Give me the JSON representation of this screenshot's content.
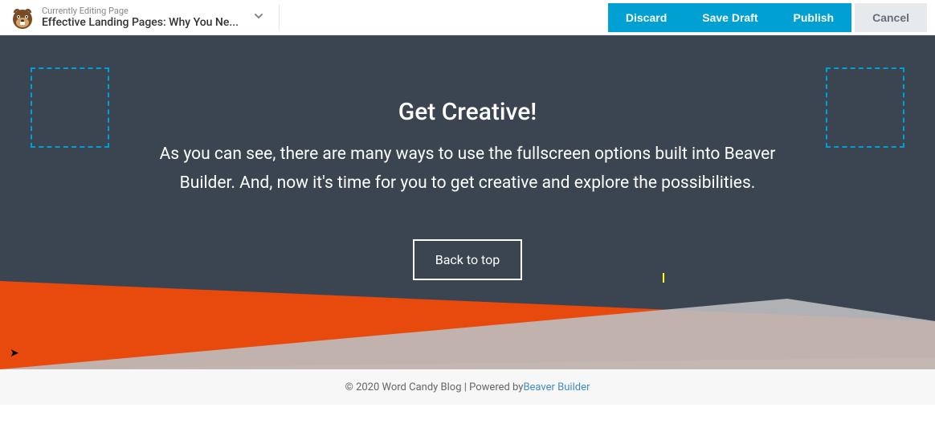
{
  "toolbar": {
    "editing_label": "Currently Editing Page",
    "page_title": "Effective Landing Pages: Why You Ne...",
    "discard": "Discard",
    "save_draft": "Save Draft",
    "publish": "Publish",
    "cancel": "Cancel"
  },
  "hero": {
    "heading": "Get Creative!",
    "body": "As you can see, there are many ways to use the fullscreen options built into Beaver Builder. And, now it's time for you to get creative and explore the possibilities.",
    "button": "Back to top"
  },
  "footer": {
    "prefix": "© 2020 Word Candy Blog | Powered by ",
    "link_text": "Beaver Builder"
  },
  "colors": {
    "accent": "#00a0d2",
    "hero_bg": "#3b4451",
    "orange_light": "#ff7a3c",
    "orange_dark": "#e84a0e"
  }
}
